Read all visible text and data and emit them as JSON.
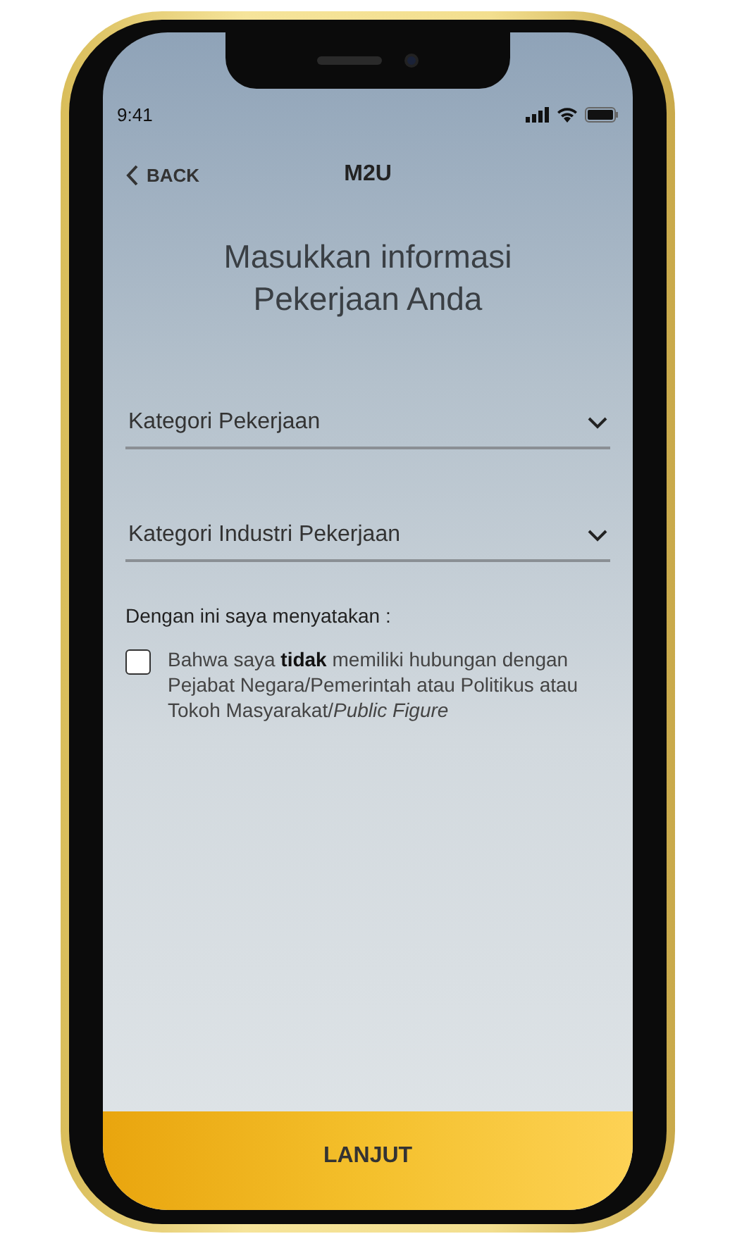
{
  "status_bar": {
    "time": "9:41"
  },
  "nav": {
    "back": "BACK",
    "title": "M2U"
  },
  "heading": "Masukkan informasi Pekerjaan Anda",
  "dropdowns": [
    {
      "placeholder": "Kategori Pekerjaan"
    },
    {
      "placeholder": "Kategori Industri Pekerjaan"
    }
  ],
  "declaration": {
    "label": "Dengan ini saya menyatakan :",
    "checked": false,
    "text": "Bahwa saya **tidak** memiliki hubungan dengan Pejabat Negara/Pemerintah atau Politikus atau Tokoh Masyarakat/*Public Figure*"
  },
  "button": "LANJUT"
}
